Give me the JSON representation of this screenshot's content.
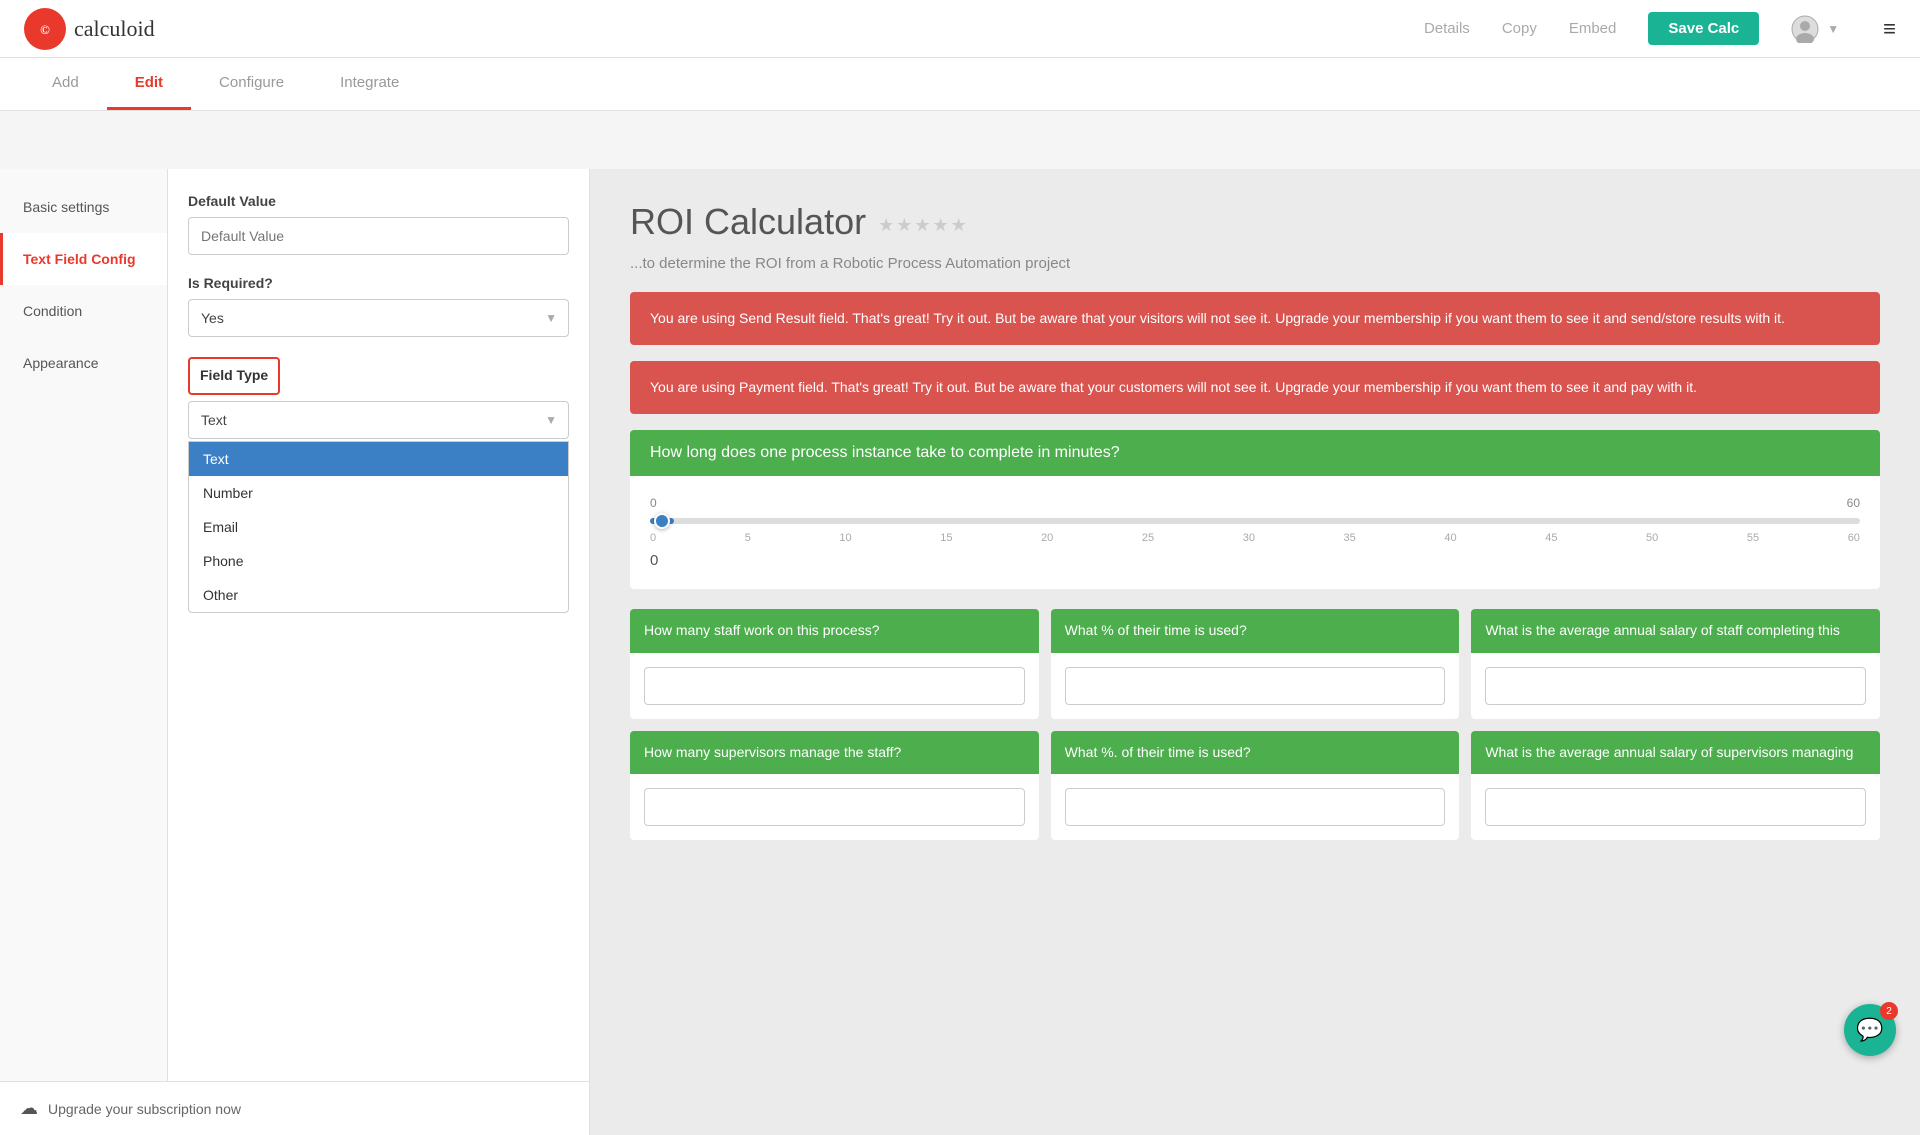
{
  "brand": {
    "name": "calculoid",
    "logo_symbol": "©"
  },
  "nav": {
    "details_label": "Details",
    "copy_label": "Copy",
    "embed_label": "Embed",
    "save_button_label": "Save Calc"
  },
  "sub_tabs": [
    {
      "id": "add",
      "label": "Add",
      "active": false
    },
    {
      "id": "edit",
      "label": "Edit",
      "active": true
    },
    {
      "id": "configure",
      "label": "Configure",
      "active": false
    },
    {
      "id": "integrate",
      "label": "Integrate",
      "active": false
    }
  ],
  "sidebar": {
    "items": [
      {
        "id": "basic-settings",
        "label": "Basic settings",
        "active": false
      },
      {
        "id": "text-field-config",
        "label": "Text Field Config",
        "active": true
      },
      {
        "id": "condition",
        "label": "Condition",
        "active": false
      },
      {
        "id": "appearance",
        "label": "Appearance",
        "active": false
      }
    ]
  },
  "config": {
    "default_value_label": "Default Value",
    "default_value_placeholder": "Default Value",
    "is_required_label": "Is Required?",
    "is_required_value": "Yes",
    "field_type_label": "Field Type",
    "field_type_value": "Text",
    "field_type_options": [
      {
        "id": "text",
        "label": "Text",
        "selected": true
      },
      {
        "id": "number",
        "label": "Number",
        "selected": false
      },
      {
        "id": "email",
        "label": "Email",
        "selected": false
      },
      {
        "id": "phone",
        "label": "Phone",
        "selected": false
      },
      {
        "id": "other",
        "label": "Other",
        "selected": false
      }
    ]
  },
  "upgrade": {
    "label": "Upgrade your subscription now"
  },
  "preview": {
    "title": "ROI Calculator",
    "subtitle": "...to determine the ROI from a Robotic Process Automation project",
    "stars": [
      false,
      false,
      false,
      false,
      false
    ],
    "alerts": [
      {
        "text": "You are using Send Result field. That's great! Try it out. But be aware that your visitors will not see it. Upgrade your membership if you want them to see it and send/store results with it."
      },
      {
        "text": "You are using Payment field. That's great! Try it out. But be aware that your customers will not see it. Upgrade your membership if you want them to see it and pay with it."
      }
    ],
    "slider_question": "How long does one process instance take to complete in minutes?",
    "slider_min": "0",
    "slider_max": "60",
    "slider_ticks": [
      "0",
      "5",
      "10",
      "15",
      "20",
      "25",
      "30",
      "35",
      "40",
      "45",
      "50",
      "55",
      "60"
    ],
    "slider_value": "0",
    "cards_row1": [
      {
        "question": "How many staff work on this process?",
        "value": ""
      },
      {
        "question": "What % of their time is used?",
        "value": ""
      },
      {
        "question": "What is the average annual salary of staff completing this",
        "value": ""
      }
    ],
    "cards_row2": [
      {
        "question": "How many supervisors manage the staff?",
        "value": ""
      },
      {
        "question": "What %. of their time is used?",
        "value": ""
      },
      {
        "question": "What is the average annual salary of supervisors managing",
        "value": ""
      }
    ],
    "chat_badge": "2"
  }
}
